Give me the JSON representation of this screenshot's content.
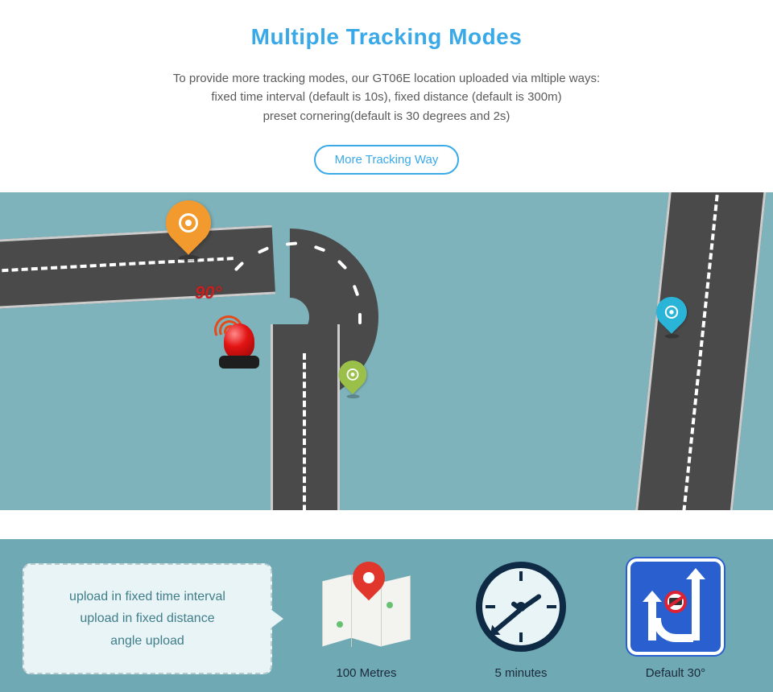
{
  "header": {
    "title": "Multiple Tracking Modes",
    "desc_line1": "To provide more tracking modes, our GT06E location uploaded via mltiple ways:",
    "desc_line2": "fixed time interval (default is 10s), fixed distance (default is 300m)",
    "desc_line3": "preset cornering(default is 30 degrees and 2s)",
    "cta_label": "More Tracking Way"
  },
  "map": {
    "angle_label": "90°",
    "pins": {
      "orange": "location-pin-orange",
      "green": "location-pin-green",
      "blue": "location-pin-blue"
    },
    "alarm_icon": "siren-alarm"
  },
  "footer": {
    "speech": {
      "line1": "upload in fixed time interval",
      "line2": "upload in fixed distance",
      "line3": "angle upload"
    },
    "metrics": [
      {
        "icon": "map-pin-icon",
        "caption": "100 Metres"
      },
      {
        "icon": "clock-icon",
        "caption": "5 minutes"
      },
      {
        "icon": "road-sign-icon",
        "caption": "Default 30°"
      }
    ]
  },
  "colors": {
    "accent": "#3aa9e8",
    "map_bg": "#7eb3bc",
    "footer_bg": "#6fa9b3",
    "alert_red": "#c62020",
    "sign_blue": "#2a5fd0"
  }
}
